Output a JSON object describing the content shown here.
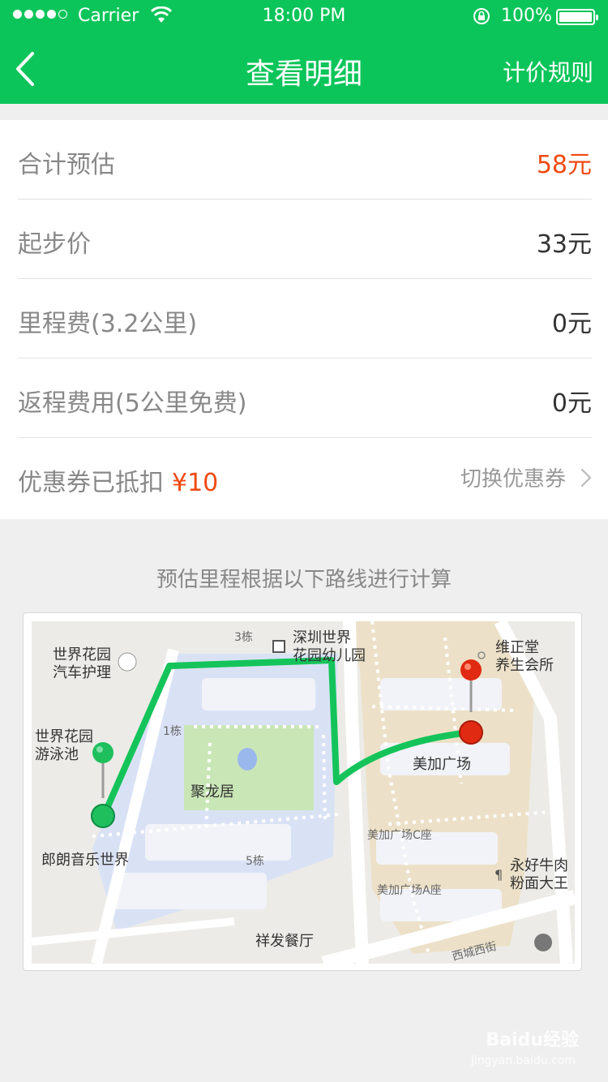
{
  "status_bar": {
    "carrier": "Carrier",
    "time": "18:00 PM",
    "battery": "100%"
  },
  "nav": {
    "title": "查看明细",
    "right_action": "计价规则",
    "back_icon": "chevron-left-icon"
  },
  "fare": {
    "rows": [
      {
        "label": "合计预估",
        "value": "58元"
      },
      {
        "label": "起步价",
        "value": "33元"
      },
      {
        "label": "里程费(3.2公里)",
        "value": "0元"
      },
      {
        "label": "返程费用(5公里免费)",
        "value": "0元"
      }
    ],
    "coupon": {
      "label": "优惠券已抵扣",
      "amount": "¥10",
      "action": "切换优惠券"
    }
  },
  "route_caption": "预估里程根据以下路线进行计算",
  "map": {
    "labels": {
      "garden_car": [
        "世界花园",
        "汽车护理"
      ],
      "garden_pool": [
        "世界花园",
        "游泳池"
      ],
      "kindergarten": [
        "深圳世界",
        "花园幼儿园"
      ],
      "weizheng": [
        "维正堂",
        "养生会所"
      ],
      "julongju": "聚龙居",
      "meijia": "美加广场",
      "meijia_c": "美加广场C座",
      "meijia_a": "美加广场A座",
      "langlang": "郎朗音乐世界",
      "yonghao": [
        "永好牛肉",
        "粉面大王"
      ],
      "xiangfa": "祥发餐厅",
      "street": "西城西街",
      "b3": "3栋",
      "b1": "1栋",
      "b5": "5栋"
    },
    "colors": {
      "route": "#14c45a",
      "start_pin": "#1fbf5e",
      "end_pin": "#e02a12"
    }
  },
  "watermark": {
    "text": "Baidu经验",
    "sub": "jingyan.baidu.com"
  },
  "colors": {
    "brand": "#0cc55a",
    "price_red": "#f04a12"
  }
}
